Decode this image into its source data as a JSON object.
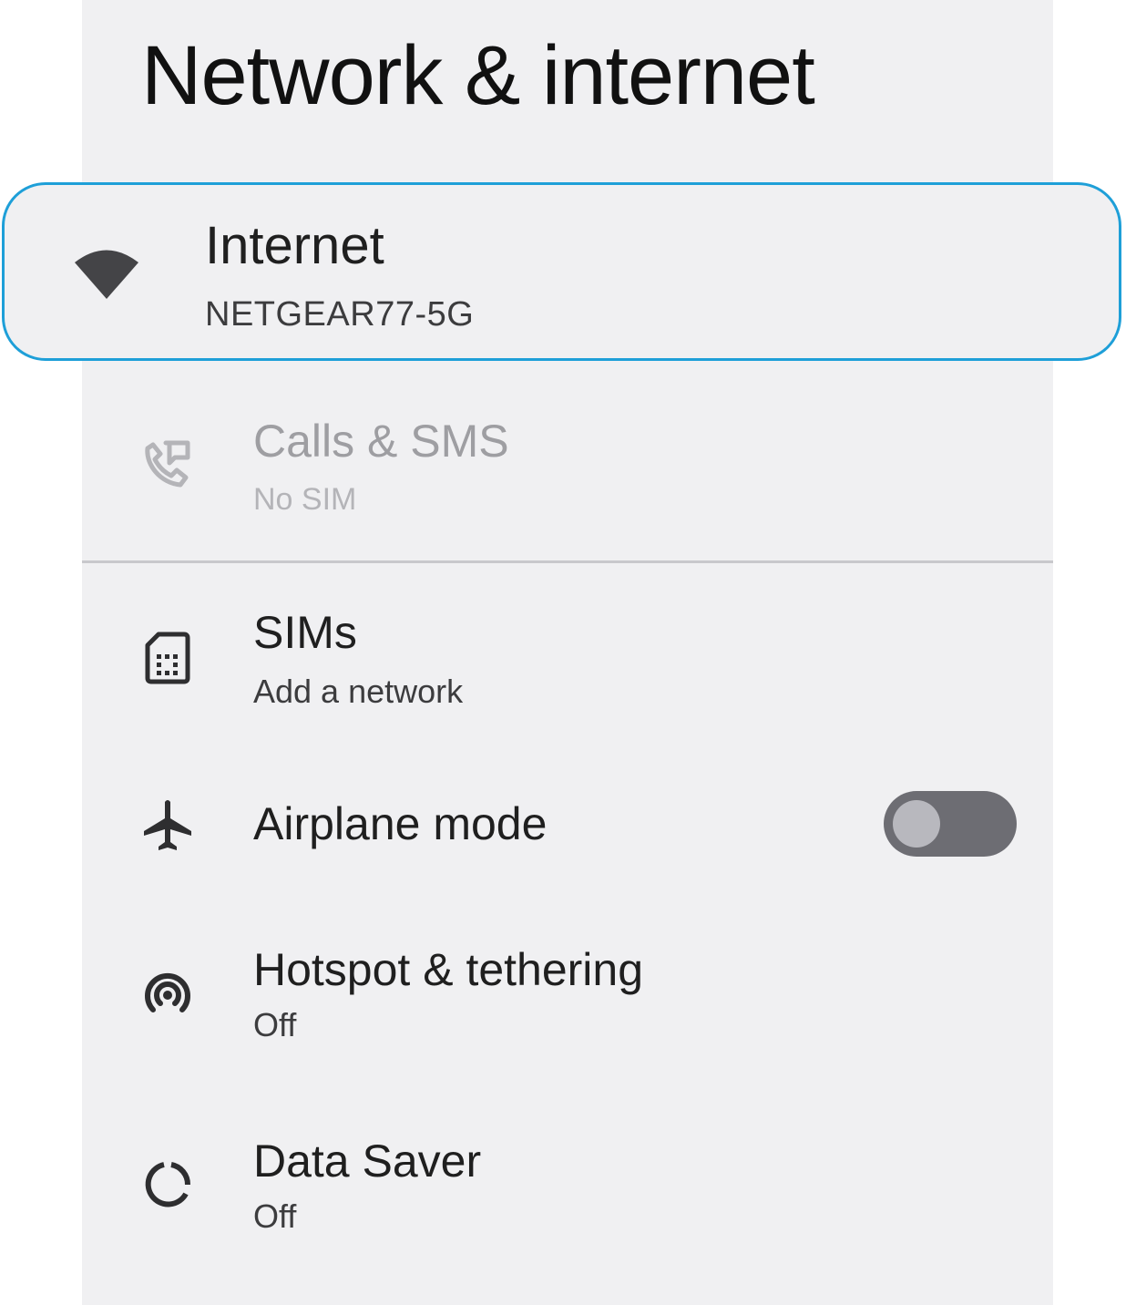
{
  "page": {
    "title": "Network & internet"
  },
  "items": {
    "internet": {
      "title": "Internet",
      "subtitle": "NETGEAR77-5G",
      "icon": "wifi-icon",
      "highlighted": true
    },
    "calls": {
      "title": "Calls & SMS",
      "subtitle": "No SIM",
      "icon": "calls-sms-icon",
      "disabled": true
    },
    "sims": {
      "title": "SIMs",
      "subtitle": "Add a network",
      "icon": "sim-card-icon"
    },
    "airplane": {
      "title": "Airplane mode",
      "icon": "airplane-icon",
      "toggle_on": false
    },
    "hotspot": {
      "title": "Hotspot & tethering",
      "subtitle": "Off",
      "icon": "hotspot-icon"
    },
    "datasaver": {
      "title": "Data Saver",
      "subtitle": "Off",
      "icon": "data-saver-icon"
    }
  },
  "colors": {
    "highlight_border": "#1e9fd8",
    "background": "#f0f0f2",
    "toggle_track_off": "#6d6d73",
    "toggle_knob_off": "#b8b8be"
  }
}
